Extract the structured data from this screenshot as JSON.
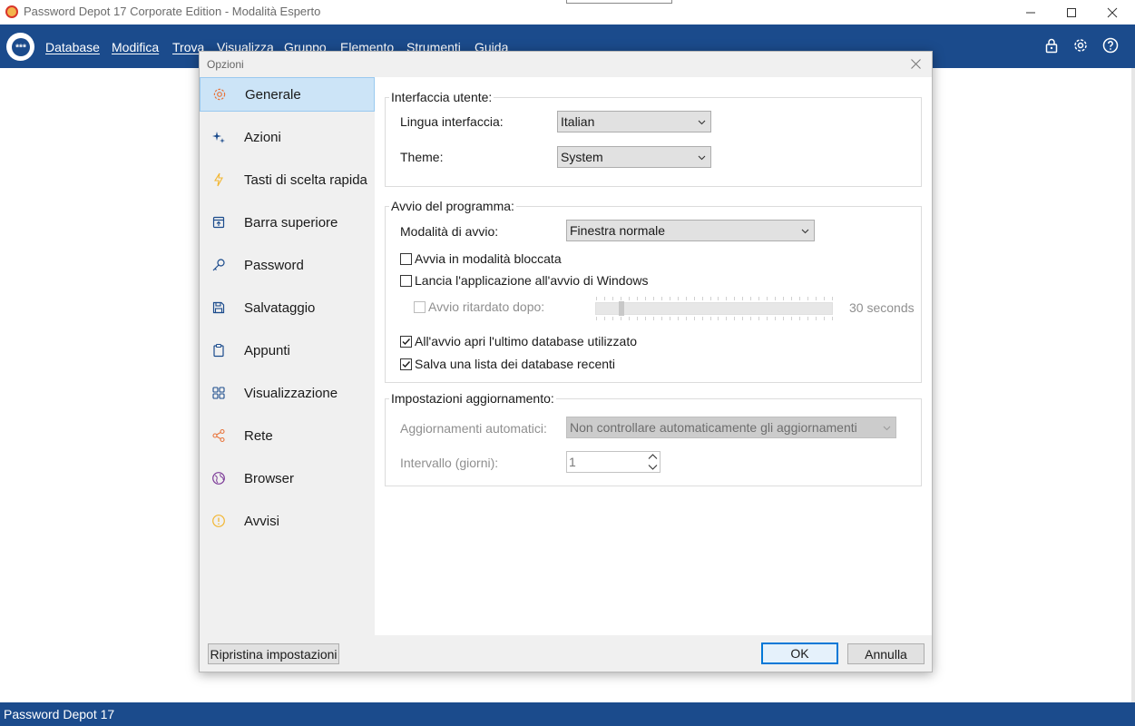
{
  "window": {
    "title": "Password Depot 17 Corporate Edition - Modalità Esperto"
  },
  "menu": {
    "items": [
      "Database",
      "Modifica",
      "Trova",
      "Visualizza",
      "Gruppo",
      "Elemento",
      "Strumenti",
      "Guida"
    ],
    "right_icons": [
      "lock-icon",
      "gear-icon",
      "help-icon"
    ]
  },
  "statusbar": {
    "text": "Password Depot 17"
  },
  "dialog": {
    "title": "Opzioni",
    "nav": [
      {
        "label": "Generale",
        "icon": "gear-icon",
        "color": "#e8743b",
        "active": true
      },
      {
        "label": "Azioni",
        "icon": "sparkle-icon",
        "color": "#1b4b8c"
      },
      {
        "label": "Tasti di scelta rapida",
        "icon": "lightning-icon",
        "color": "#f2b632"
      },
      {
        "label": "Barra superiore",
        "icon": "topbar-icon",
        "color": "#1b4b8c"
      },
      {
        "label": "Password",
        "icon": "key-icon",
        "color": "#1b4b8c"
      },
      {
        "label": "Salvataggio",
        "icon": "save-icon",
        "color": "#1b4b8c"
      },
      {
        "label": "Appunti",
        "icon": "clipboard-icon",
        "color": "#1b4b8c"
      },
      {
        "label": "Visualizzazione",
        "icon": "grid-icon",
        "color": "#1b4b8c"
      },
      {
        "label": "Rete",
        "icon": "share-icon",
        "color": "#e8743b"
      },
      {
        "label": "Browser",
        "icon": "globe-icon",
        "color": "#7d3c98"
      },
      {
        "label": "Avvisi",
        "icon": "alert-icon",
        "color": "#f2b632"
      }
    ],
    "interface_group": {
      "title": "Interfaccia utente:",
      "language_label": "Lingua interfaccia:",
      "language_value": "Italian",
      "theme_label": "Theme:",
      "theme_value": "System"
    },
    "startup_group": {
      "title": "Avvio del programma:",
      "mode_label": "Modalità di avvio:",
      "mode_value": "Finestra normale",
      "locked_label": "Avvia in modalità bloccata",
      "locked_checked": false,
      "autostart_label": "Lancia l'applicazione all'avvio di Windows",
      "autostart_checked": false,
      "delay_label": "Avvio ritardato dopo:",
      "delay_checked": false,
      "delay_value": "30 seconds",
      "delay_slider_fraction": 0.1,
      "open_last_label": "All'avvio apri l'ultimo database utilizzato",
      "open_last_checked": true,
      "save_recent_label": "Salva una lista dei database recenti",
      "save_recent_checked": true
    },
    "update_group": {
      "title": "Impostazioni aggiornamento:",
      "auto_label": "Aggiornamenti automatici:",
      "auto_value": "Non controllare automaticamente gli aggiornamenti",
      "interval_label": "Intervallo (giorni):",
      "interval_value": "1"
    },
    "buttons": {
      "reset": "Ripristina impostazioni",
      "ok": "OK",
      "cancel": "Annulla"
    }
  }
}
